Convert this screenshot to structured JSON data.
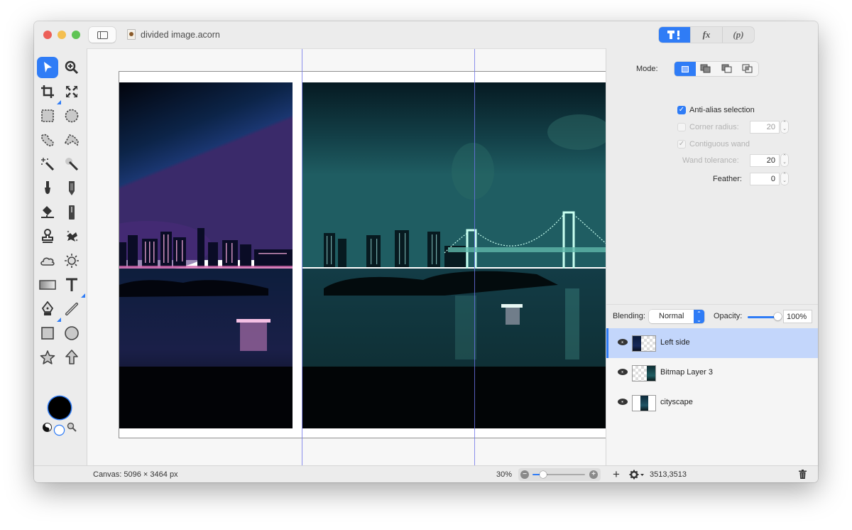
{
  "window": {
    "title": "divided image.acorn",
    "controls": [
      "close",
      "minimize",
      "zoom"
    ]
  },
  "inspector_tabs": [
    {
      "id": "tools",
      "label": "T!",
      "icon": "tool-options-icon",
      "active": true
    },
    {
      "id": "filters",
      "label": "fx",
      "icon": "filters-icon",
      "active": false
    },
    {
      "id": "properties",
      "label": "(p)",
      "icon": "properties-icon",
      "active": false
    }
  ],
  "toolbox": {
    "tools": [
      {
        "name": "select-arrow",
        "glyph": "➤",
        "active": true
      },
      {
        "name": "zoom",
        "glyph": "🔍︎",
        "active": false
      },
      {
        "name": "crop",
        "glyph": "⌗",
        "active": false,
        "submenu": true
      },
      {
        "name": "transform",
        "glyph": "⤧",
        "active": false
      },
      {
        "name": "rect-select",
        "glyph": "⬚",
        "active": false
      },
      {
        "name": "ellipse-select",
        "glyph": "◌",
        "active": false
      },
      {
        "name": "lasso",
        "glyph": "ᘐ",
        "active": false
      },
      {
        "name": "polygon-lasso",
        "glyph": "⏢",
        "active": false
      },
      {
        "name": "magic-wand",
        "glyph": "⚝",
        "active": false
      },
      {
        "name": "color-select-wand",
        "glyph": "⚚",
        "active": false
      },
      {
        "name": "brush",
        "glyph": "🖌︎",
        "active": false
      },
      {
        "name": "pencil",
        "glyph": "✎",
        "active": false
      },
      {
        "name": "paint-bucket",
        "glyph": "⛾",
        "active": false
      },
      {
        "name": "eraser",
        "glyph": "▮",
        "active": false
      },
      {
        "name": "clone-stamp",
        "glyph": "♙",
        "active": false
      },
      {
        "name": "smudge",
        "glyph": "✺",
        "active": false
      },
      {
        "name": "burn",
        "glyph": "☁",
        "active": false
      },
      {
        "name": "dodge",
        "glyph": "☼",
        "active": false
      },
      {
        "name": "gradient",
        "glyph": "▭",
        "active": false
      },
      {
        "name": "text",
        "glyph": "T",
        "active": false,
        "submenu": true
      },
      {
        "name": "bezier-pen",
        "glyph": "✒",
        "active": false,
        "submenu": true
      },
      {
        "name": "line",
        "glyph": "╱",
        "active": false
      },
      {
        "name": "rectangle",
        "glyph": "■",
        "active": false
      },
      {
        "name": "oval",
        "glyph": "●",
        "active": false
      },
      {
        "name": "star",
        "glyph": "☆",
        "active": false
      },
      {
        "name": "arrow-shape",
        "glyph": "⇧",
        "active": false
      }
    ],
    "color_well": "#000000"
  },
  "canvas": {
    "guides": 2
  },
  "tool_options": {
    "mode_label": "Mode:",
    "modes": [
      {
        "id": "replace",
        "active": true
      },
      {
        "id": "add",
        "active": false
      },
      {
        "id": "subtract",
        "active": false
      },
      {
        "id": "intersect",
        "active": false
      }
    ],
    "anti_alias": {
      "label": "Anti-alias selection",
      "checked": true,
      "enabled": true
    },
    "corner_radius": {
      "label": "Corner radius:",
      "checked": false,
      "enabled": false,
      "value": "20"
    },
    "contiguous_wand": {
      "label": "Contiguous wand",
      "checked": true,
      "enabled": false
    },
    "wand_tolerance": {
      "label": "Wand tolerance:",
      "enabled": false,
      "value": "20"
    },
    "feather": {
      "label": "Feather:",
      "enabled": true,
      "value": "0"
    }
  },
  "layers_bar": {
    "blending_label": "Blending:",
    "blending_value": "Normal",
    "opacity_label": "Opacity:",
    "opacity_value": "100%",
    "opacity_fraction": 1.0
  },
  "layers": [
    {
      "name": "Left side",
      "visible": true,
      "selected": true,
      "thumb": "left"
    },
    {
      "name": "Bitmap Layer 3",
      "visible": true,
      "selected": false,
      "thumb": "right"
    },
    {
      "name": "cityscape",
      "visible": true,
      "selected": false,
      "thumb": "center"
    }
  ],
  "status": {
    "canvas_size": "Canvas: 5096 × 3464 px",
    "zoom_level": "30%",
    "zoom_fraction": 0.2,
    "add_label": "+",
    "coordinates": "3513,3513"
  }
}
